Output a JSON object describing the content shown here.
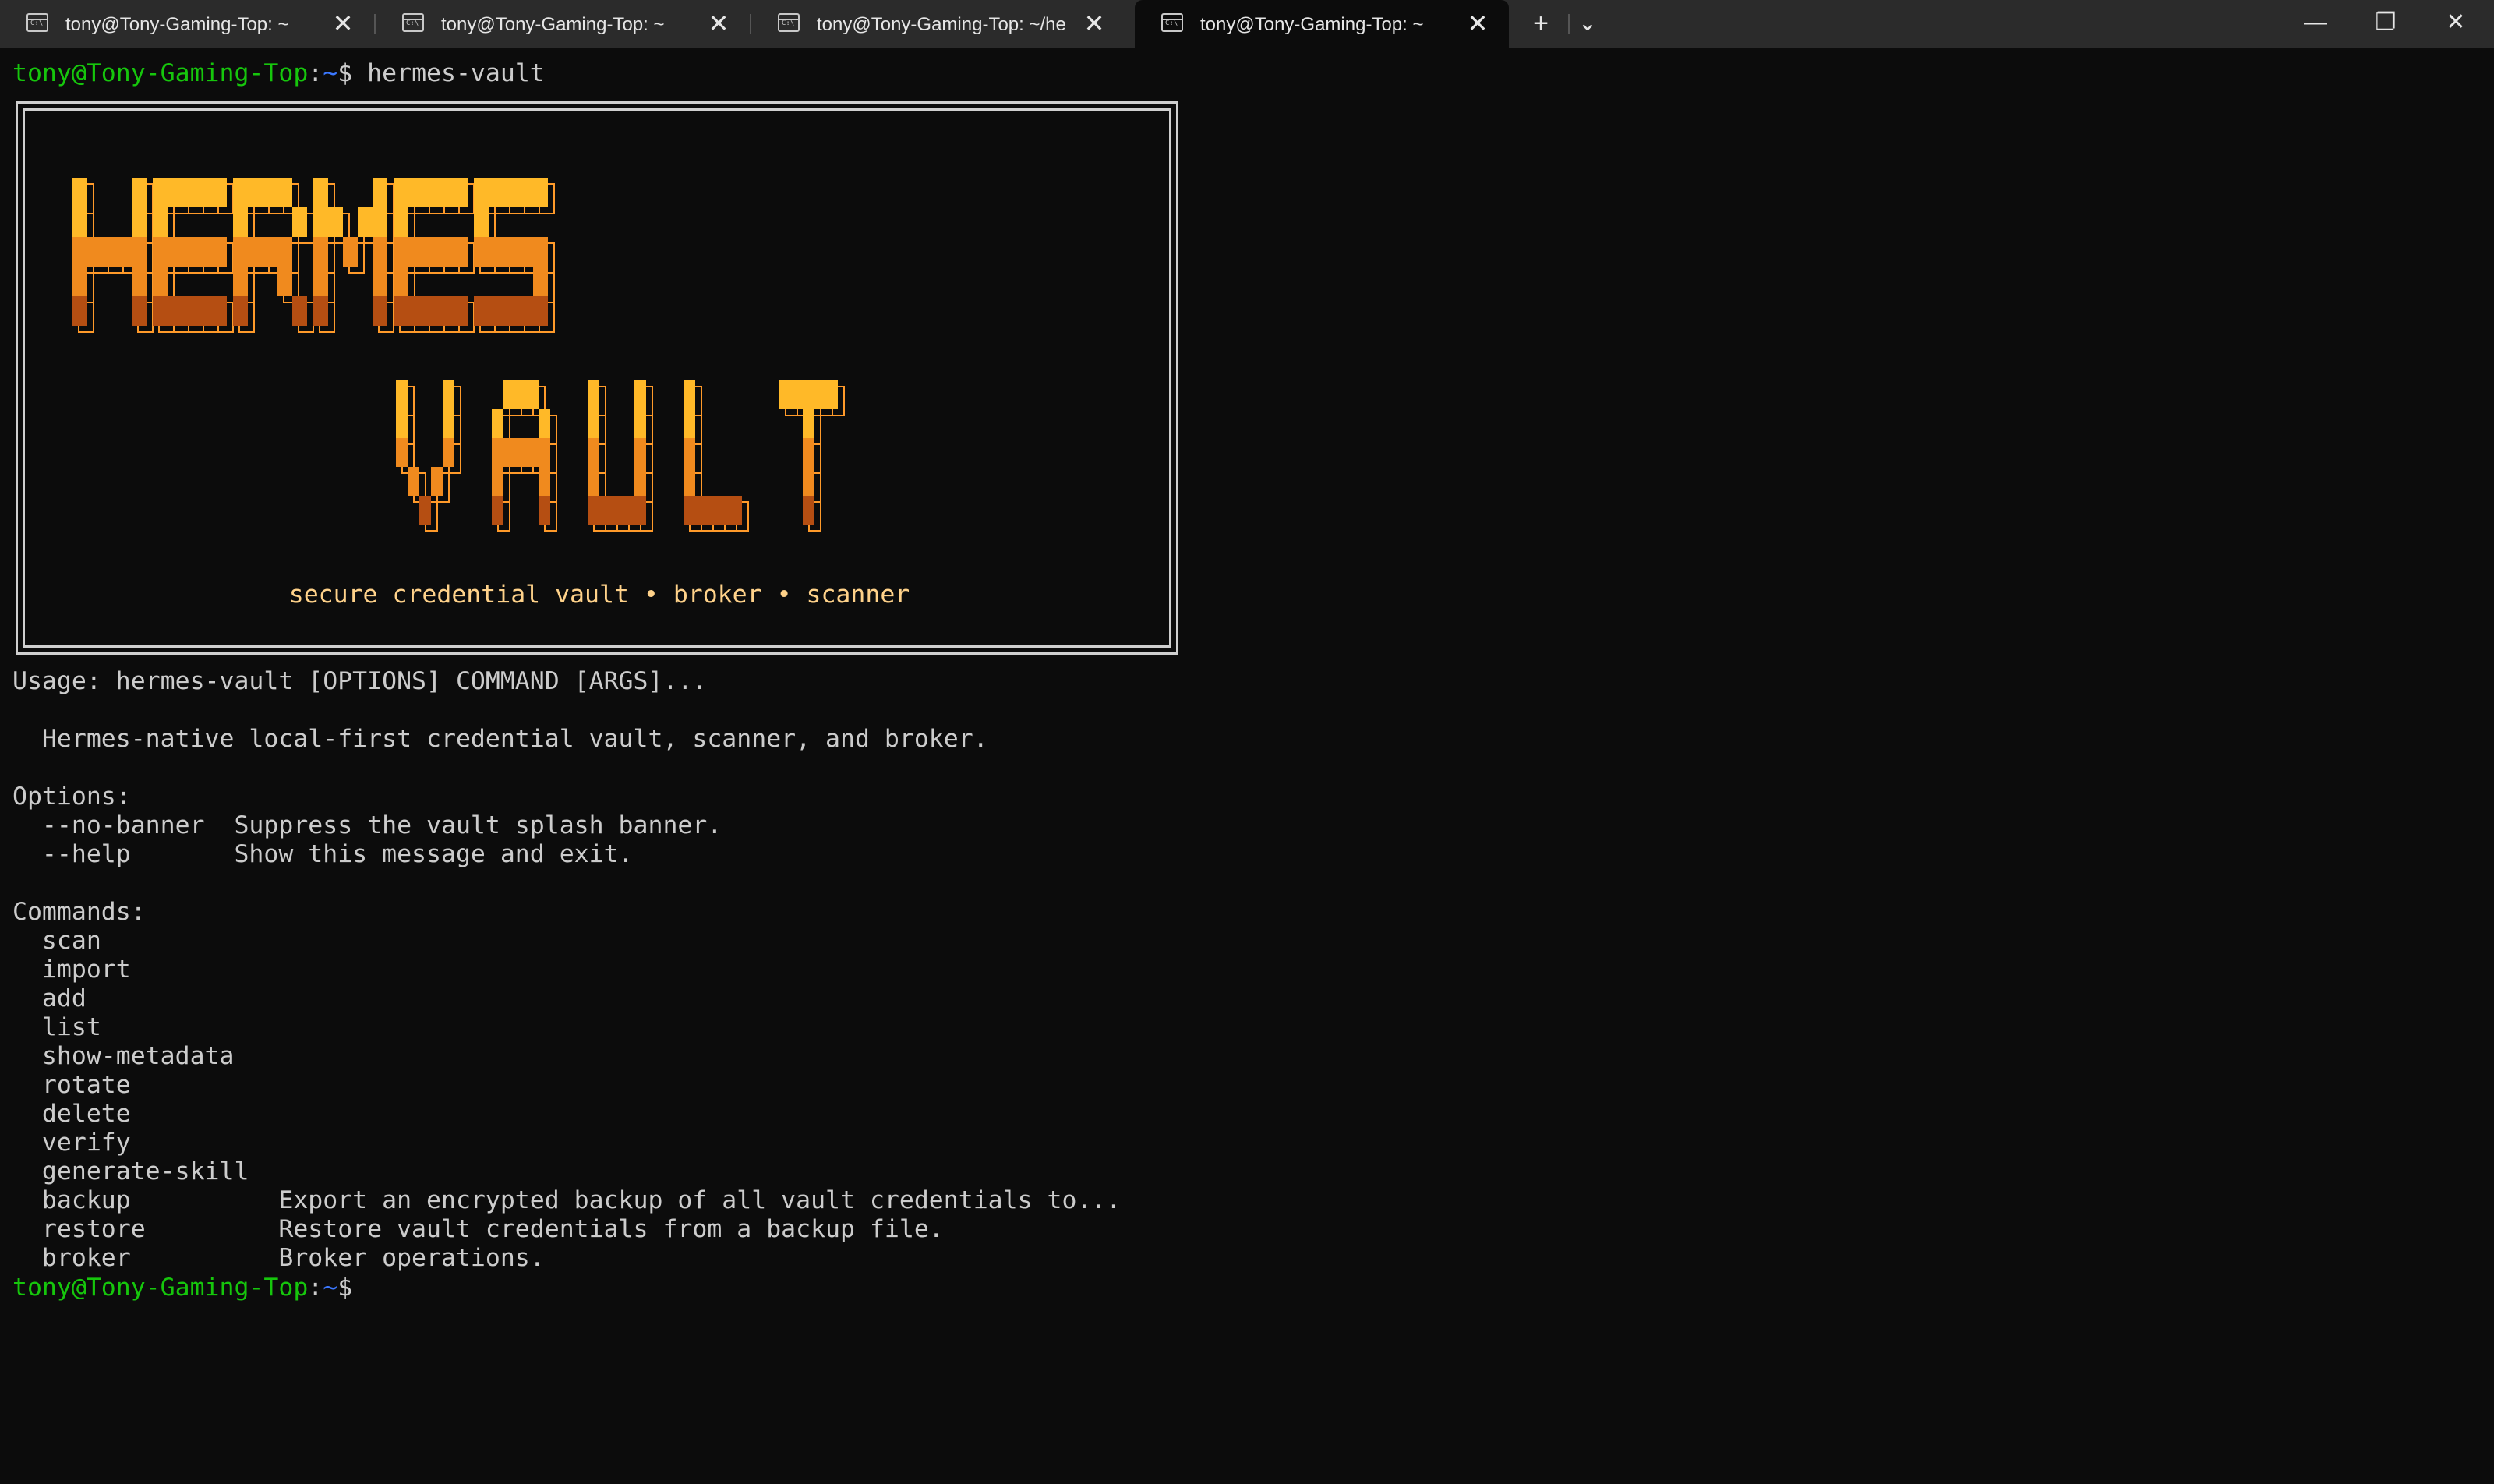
{
  "tabs": [
    {
      "title": "tony@Tony-Gaming-Top: ~",
      "active": false
    },
    {
      "title": "tony@Tony-Gaming-Top: ~",
      "active": false
    },
    {
      "title": "tony@Tony-Gaming-Top: ~/he",
      "active": false
    },
    {
      "title": "tony@Tony-Gaming-Top: ~",
      "active": true
    }
  ],
  "controls": {
    "close": "✕",
    "new_tab": "+",
    "dropdown": "⌄",
    "minimize": "—",
    "restore": "❐",
    "window_close": "✕"
  },
  "prompt": {
    "user_host": "tony@Tony-Gaming-Top",
    "colon": ":",
    "cwd": "~",
    "symbol": "$ "
  },
  "command": "hermes-vault",
  "banner": {
    "tagline": "secure credential vault • broker • scanner",
    "words": [
      "HERMES",
      "VAULT"
    ],
    "colors": {
      "top": "#ffb928",
      "middle": "#f08a1e",
      "bottom": "#b54e12",
      "outline": "#ff9a2a"
    }
  },
  "output": [
    "Usage: hermes-vault [OPTIONS] COMMAND [ARGS]...",
    "",
    "  Hermes-native local-first credential vault, scanner, and broker.",
    "",
    "Options:",
    "  --no-banner  Suppress the vault splash banner.",
    "  --help       Show this message and exit.",
    "",
    "Commands:",
    "  scan",
    "  import",
    "  add",
    "  list",
    "  show-metadata",
    "  rotate",
    "  delete",
    "  verify",
    "  generate-skill",
    "  backup          Export an encrypted backup of all vault credentials to...",
    "  restore         Restore vault credentials from a backup file.",
    "  broker          Broker operations."
  ]
}
